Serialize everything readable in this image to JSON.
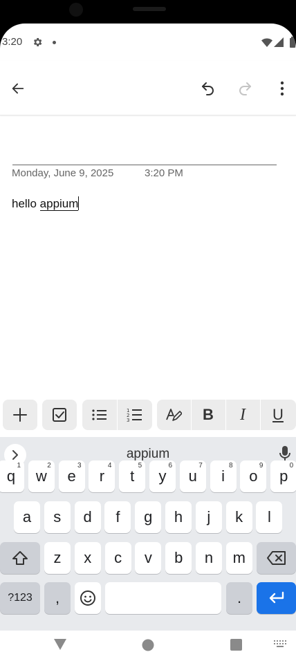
{
  "status_bar": {
    "time": "3:20"
  },
  "toolbar": {
    "back": "back-arrow-icon",
    "undo": "undo-icon",
    "redo": "redo-icon",
    "more": "more-vert-icon"
  },
  "note": {
    "date": "Monday, June 9, 2025",
    "time": "3:20 PM",
    "text_plain": "hello",
    "text_underlined": "appium"
  },
  "format_toolbar": {
    "items": [
      "add-icon",
      "checkbox-icon",
      "bulleted-list-icon",
      "numbered-list-icon",
      "text-style-icon",
      "bold-icon",
      "italic-icon",
      "underline-icon"
    ]
  },
  "keyboard": {
    "suggestion": "appium",
    "row1": [
      "q",
      "w",
      "e",
      "r",
      "t",
      "y",
      "u",
      "i",
      "o",
      "p"
    ],
    "row1_hints": [
      "1",
      "2",
      "3",
      "4",
      "5",
      "6",
      "7",
      "8",
      "9",
      "0"
    ],
    "row2": [
      "a",
      "s",
      "d",
      "f",
      "g",
      "h",
      "j",
      "k",
      "l"
    ],
    "row3": [
      "z",
      "x",
      "c",
      "v",
      "b",
      "n",
      "m"
    ],
    "symbols_key": "?123",
    "comma_key": ",",
    "period_key": "."
  },
  "colors": {
    "accent": "#1a73e8",
    "keyboard_bg": "#e8eaed"
  }
}
